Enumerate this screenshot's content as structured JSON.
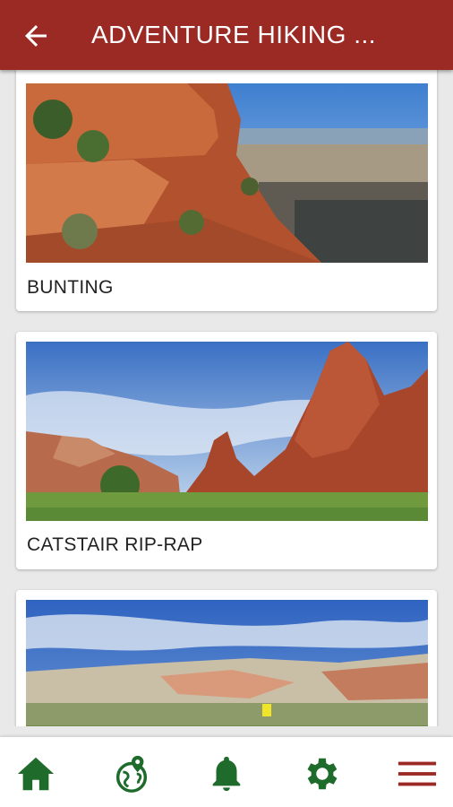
{
  "appbar": {
    "title": "ADVENTURE HIKING ..."
  },
  "trails": [
    {
      "name": "BUNTING"
    },
    {
      "name": "CATSTAIR RIP-RAP"
    },
    {
      "name": ""
    }
  ],
  "bottom_nav": [
    {
      "icon": "home-icon"
    },
    {
      "icon": "globe-map-icon"
    },
    {
      "icon": "bell-icon"
    },
    {
      "icon": "gear-icon"
    },
    {
      "icon": "hamburger-menu-icon"
    }
  ],
  "colors": {
    "appbar": "#9b2a25",
    "nav_icon_green": "#1f6b2b",
    "menu_icon_red": "#9b2a25"
  }
}
